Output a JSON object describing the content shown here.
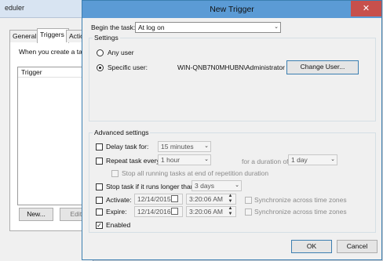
{
  "background_window": {
    "title": "eduler",
    "tabs": [
      "General",
      "Triggers",
      "Action"
    ],
    "info_text": "When you create a task,",
    "list_header": "Trigger",
    "buttons": {
      "new": "New...",
      "edit": "Edit."
    }
  },
  "dialog": {
    "title": "New Trigger",
    "close_glyph": "✕",
    "begin_task_label": "Begin the task:",
    "begin_task_value": "At log on",
    "settings_group": "Settings",
    "any_user_label": "Any user",
    "specific_user_label": "Specific user:",
    "user_name": "WIN-QNB7N0MHUBN\\Administrator",
    "change_user_button": "Change User...",
    "advanced_group": "Advanced settings",
    "delay_label": "Delay task for:",
    "delay_value": "15 minutes",
    "repeat_label": "Repeat task every:",
    "repeat_value": "1 hour",
    "duration_label": "for a duration of:",
    "duration_value": "1 day",
    "stop_all_label": "Stop all running tasks at end of repetition duration",
    "stop_if_label": "Stop task if it runs longer than:",
    "stop_if_value": "3 days",
    "activate_label": "Activate:",
    "activate_date": "12/14/2015",
    "activate_time": "3:20:06 AM",
    "expire_label": "Expire:",
    "expire_date": "12/14/2016",
    "expire_time": "3:20:06 AM",
    "sync_label": "Synchronize across time zones",
    "enabled_label": "Enabled",
    "enabled_checked": "✓",
    "ok_button": "OK",
    "cancel_button": "Cancel",
    "combo_arrow": "⌄",
    "spin_up": "▲",
    "spin_down": "▼"
  }
}
